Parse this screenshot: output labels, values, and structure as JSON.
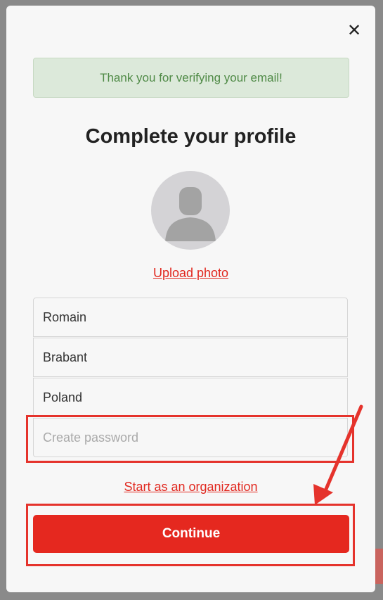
{
  "modal": {
    "close_icon": "✕",
    "alert_text": "Thank you for verifying your email!",
    "title": "Complete your profile",
    "avatar_icon": "user-silhouette",
    "upload_photo_label": "Upload photo",
    "fields": {
      "first_name": {
        "value": "Romain"
      },
      "last_name": {
        "value": "Brabant"
      },
      "country": {
        "value": "Poland"
      },
      "password": {
        "value": "",
        "placeholder": "Create password"
      }
    },
    "org_link_label": "Start as an organization",
    "continue_label": "Continue"
  },
  "colors": {
    "accent": "#e5281f",
    "alert_bg": "#dce9da",
    "alert_text": "#4f8a46",
    "annotation": "#e5332c"
  }
}
